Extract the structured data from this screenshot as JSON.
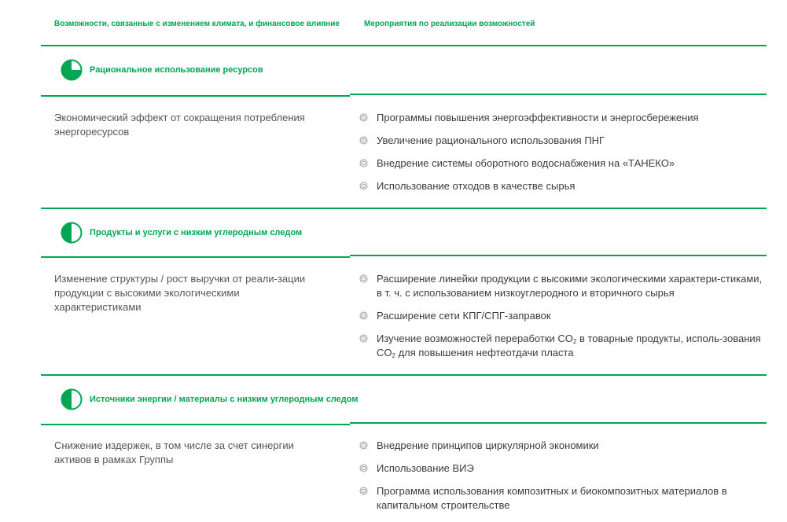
{
  "header": {
    "col_opportunities": "Возможности, связанные с изменением климата, и финансовое влияние",
    "col_measures": "Мероприятия по реализации возможностей"
  },
  "colors": {
    "accent": "#00a651"
  },
  "sections": [
    {
      "title": "Рациональное использование ресурсов",
      "icon": "three-quarter-circle-icon",
      "effect": "Экономический эффект от сокращения потребления энергоресурсов",
      "measures": [
        "Программы повышения энергоэффективности и энергосбережения",
        "Увеличение рационального использования ПНГ",
        "Внедрение системы оборотного водоснабжения на «ТАНЕКО»",
        "Использование отходов в качестве сырья"
      ]
    },
    {
      "title": "Продукты и услуги с низким углеродным следом",
      "icon": "half-circle-icon",
      "effect": "Изменение структуры / рост выручки от реали-зации продукции с высокими экологическими характеристиками",
      "measures": [
        "Расширение линейки продукции с высокими экологическими характери-стиками, в т. ч. с использованием низкоуглеродного и вторичного сырья",
        "Расширение сети КПГ/СПГ-заправок",
        {
          "a": "Изучение возможностей переработки CO",
          "sub1": "2",
          "b": " в товарные продукты, исполь-зования CO",
          "sub2": "2",
          "c": " для повышения нефтеотдачи пласта"
        }
      ]
    },
    {
      "title": "Источники энергии / материалы с низким углеродным следом",
      "icon": "half-circle-icon",
      "effect": "Снижение издержек, в том числе за счет синергии активов в рамках Группы",
      "measures": [
        "Внедрение принципов циркулярной экономики",
        "Использование ВИЭ",
        "Программа использования композитных и биокомпозитных материалов в капитальном строительстве"
      ]
    }
  ]
}
